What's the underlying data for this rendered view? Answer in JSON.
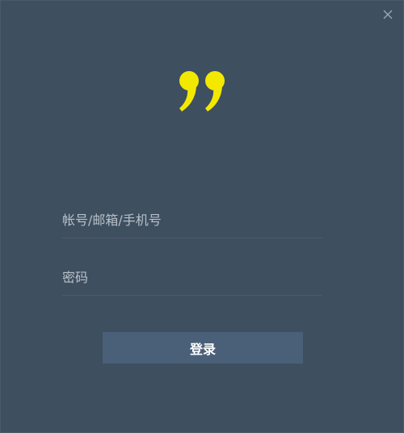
{
  "window": {
    "background": "#3e4f5f"
  },
  "brand": {
    "logo_icon": "double-quote-logo-icon",
    "logo_color": "#f3e800"
  },
  "form": {
    "username_placeholder": "帐号/邮箱/手机号",
    "username_value": "",
    "password_placeholder": "密码",
    "password_value": "",
    "login_label": "登录",
    "login_button_color": "#4a6078"
  },
  "controls": {
    "close_icon": "close-icon"
  }
}
